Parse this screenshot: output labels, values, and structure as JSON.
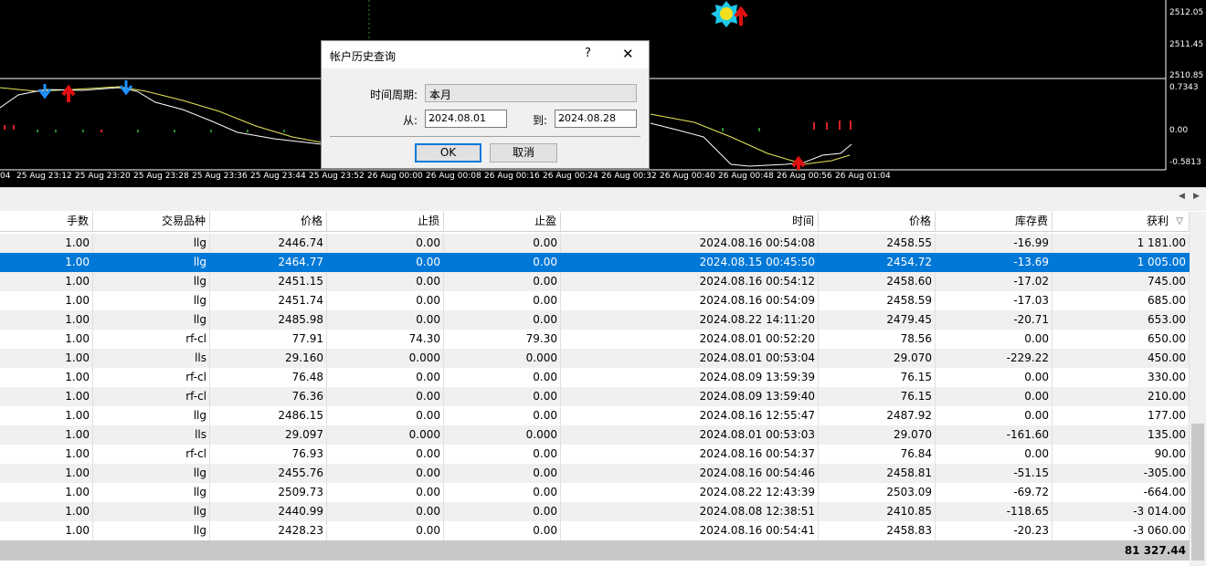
{
  "chart": {
    "price_labels": [
      "2512.05",
      "2511.45",
      "2510.85"
    ],
    "indicator_labels": [
      "0.7343",
      "0.00",
      "-0.5813"
    ],
    "time_labels": [
      "04",
      "25 Aug 23:12",
      "25 Aug 23:20",
      "25 Aug 23:28",
      "25 Aug 23:36",
      "25 Aug 23:44",
      "25 Aug 23:52",
      "26 Aug 00:00",
      "26 Aug 00:08",
      "26 Aug 00:16",
      "26 Aug 00:24",
      "26 Aug 00:32",
      "26 Aug 00:40",
      "26 Aug 00:48",
      "26 Aug 00:56",
      "26 Aug 01:04"
    ]
  },
  "dialog": {
    "title": "帐户历史查询",
    "help": "?",
    "close": "✕",
    "period_label": "时间周期:",
    "period_value": "本月",
    "from_label": "从:",
    "from_value": "2024.08.01",
    "to_label": "到:",
    "to_value": "2024.08.28",
    "ok": "OK",
    "cancel": "取消"
  },
  "table": {
    "columns": [
      "手数",
      "交易品种",
      "价格",
      "止损",
      "止盈",
      "时间",
      "价格",
      "库存费",
      "获利"
    ],
    "sort_icon": "▽",
    "rows": [
      [
        "1.00",
        "llg",
        "2446.74",
        "0.00",
        "0.00",
        "2024.08.16 00:54:08",
        "2458.55",
        "-16.99",
        "1 181.00"
      ],
      [
        "1.00",
        "llg",
        "2464.77",
        "0.00",
        "0.00",
        "2024.08.15 00:45:50",
        "2454.72",
        "-13.69",
        "1 005.00"
      ],
      [
        "1.00",
        "llg",
        "2451.15",
        "0.00",
        "0.00",
        "2024.08.16 00:54:12",
        "2458.60",
        "-17.02",
        "745.00"
      ],
      [
        "1.00",
        "llg",
        "2451.74",
        "0.00",
        "0.00",
        "2024.08.16 00:54:09",
        "2458.59",
        "-17.03",
        "685.00"
      ],
      [
        "1.00",
        "llg",
        "2485.98",
        "0.00",
        "0.00",
        "2024.08.22 14:11:20",
        "2479.45",
        "-20.71",
        "653.00"
      ],
      [
        "1.00",
        "rf-cl",
        "77.91",
        "74.30",
        "79.30",
        "2024.08.01 00:52:20",
        "78.56",
        "0.00",
        "650.00"
      ],
      [
        "1.00",
        "lls",
        "29.160",
        "0.000",
        "0.000",
        "2024.08.01 00:53:04",
        "29.070",
        "-229.22",
        "450.00"
      ],
      [
        "1.00",
        "rf-cl",
        "76.48",
        "0.00",
        "0.00",
        "2024.08.09 13:59:39",
        "76.15",
        "0.00",
        "330.00"
      ],
      [
        "1.00",
        "rf-cl",
        "76.36",
        "0.00",
        "0.00",
        "2024.08.09 13:59:40",
        "76.15",
        "0.00",
        "210.00"
      ],
      [
        "1.00",
        "llg",
        "2486.15",
        "0.00",
        "0.00",
        "2024.08.16 12:55:47",
        "2487.92",
        "0.00",
        "177.00"
      ],
      [
        "1.00",
        "lls",
        "29.097",
        "0.000",
        "0.000",
        "2024.08.01 00:53:03",
        "29.070",
        "-161.60",
        "135.00"
      ],
      [
        "1.00",
        "rf-cl",
        "76.93",
        "0.00",
        "0.00",
        "2024.08.16 00:54:37",
        "76.84",
        "0.00",
        "90.00"
      ],
      [
        "1.00",
        "llg",
        "2455.76",
        "0.00",
        "0.00",
        "2024.08.16 00:54:46",
        "2458.81",
        "-51.15",
        "-305.00"
      ],
      [
        "1.00",
        "llg",
        "2509.73",
        "0.00",
        "0.00",
        "2024.08.22 12:43:39",
        "2503.09",
        "-69.72",
        "-664.00"
      ],
      [
        "1.00",
        "llg",
        "2440.99",
        "0.00",
        "0.00",
        "2024.08.08 12:38:51",
        "2410.85",
        "-118.65",
        "-3 014.00"
      ],
      [
        "1.00",
        "llg",
        "2428.23",
        "0.00",
        "0.00",
        "2024.08.16 00:54:41",
        "2458.83",
        "-20.23",
        "-3 060.00"
      ]
    ],
    "selected_row": 1,
    "total": "81 327.44"
  }
}
